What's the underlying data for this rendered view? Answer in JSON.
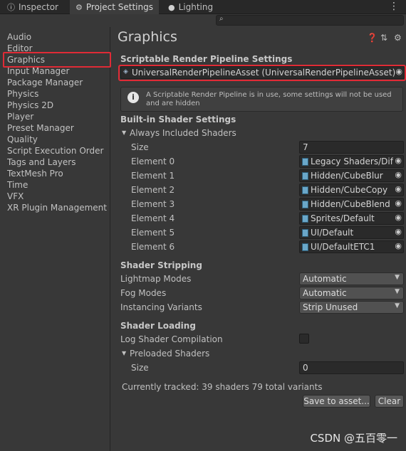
{
  "tabs": [
    {
      "label": "Inspector",
      "icon": "info-icon"
    },
    {
      "label": "Project Settings",
      "icon": "gear-icon"
    },
    {
      "label": "Lighting",
      "icon": "lightbulb-icon"
    }
  ],
  "search": {
    "placeholder": ""
  },
  "sidebar": {
    "items": [
      "Audio",
      "Editor",
      "Graphics",
      "Input Manager",
      "Package Manager",
      "Physics",
      "Physics 2D",
      "Player",
      "Preset Manager",
      "Quality",
      "Script Execution Order",
      "Tags and Layers",
      "TextMesh Pro",
      "Time",
      "VFX",
      "XR Plugin Management"
    ],
    "selected": "Graphics"
  },
  "page": {
    "title": "Graphics"
  },
  "srp": {
    "section": "Scriptable Render Pipeline Settings",
    "asset": "UniversalRenderPipelineAsset (UniversalRenderPipelineAsset)",
    "help": "A Scriptable Render Pipeline is in use, some settings will not be used and are hidden"
  },
  "builtin": {
    "section": "Built-in Shader Settings",
    "foldout": "Always Included Shaders",
    "size_label": "Size",
    "size_value": "7",
    "elements": [
      {
        "label": "Element 0",
        "value": "Legacy Shaders/Dif"
      },
      {
        "label": "Element 1",
        "value": "Hidden/CubeBlur"
      },
      {
        "label": "Element 2",
        "value": "Hidden/CubeCopy"
      },
      {
        "label": "Element 3",
        "value": "Hidden/CubeBlend"
      },
      {
        "label": "Element 4",
        "value": "Sprites/Default"
      },
      {
        "label": "Element 5",
        "value": "UI/Default"
      },
      {
        "label": "Element 6",
        "value": "UI/DefaultETC1"
      }
    ]
  },
  "stripping": {
    "section": "Shader Stripping",
    "rows": [
      {
        "label": "Lightmap Modes",
        "value": "Automatic"
      },
      {
        "label": "Fog Modes",
        "value": "Automatic"
      },
      {
        "label": "Instancing Variants",
        "value": "Strip Unused"
      }
    ]
  },
  "loading": {
    "section": "Shader Loading",
    "log_label": "Log Shader Compilation",
    "log_checked": false,
    "preloaded": "Preloaded Shaders",
    "size_label": "Size",
    "size_value": "0",
    "tracked": "Currently tracked: 39 shaders 79 total variants",
    "save_button": "Save to asset...",
    "clear_button": "Clear"
  },
  "watermark": "CSDN @五百零一",
  "colors": {
    "highlight": "#e02b36",
    "background": "#383838"
  }
}
